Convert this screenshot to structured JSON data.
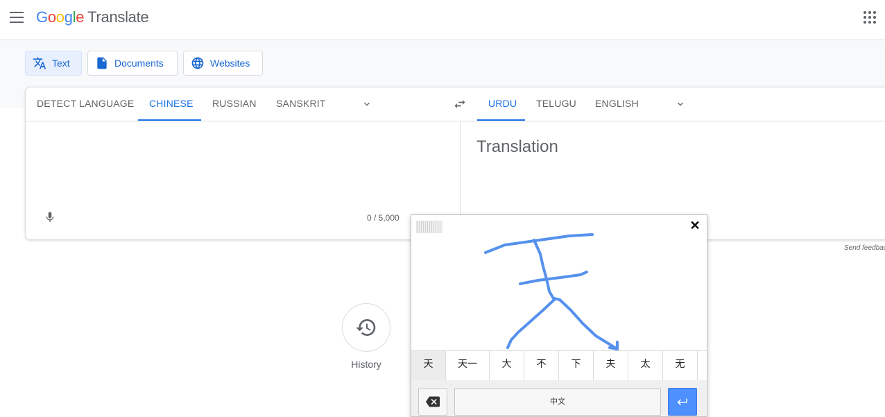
{
  "header": {
    "logo_google": [
      "G",
      "o",
      "o",
      "g",
      "l",
      "e"
    ],
    "logo_colors": [
      "#4285f4",
      "#ea4335",
      "#fbbc05",
      "#4285f4",
      "#34a853",
      "#ea4335"
    ],
    "logo_product": "Translate"
  },
  "modes": [
    {
      "label": "Text",
      "icon": "translate-icon",
      "active": true
    },
    {
      "label": "Documents",
      "icon": "document-icon",
      "active": false
    },
    {
      "label": "Websites",
      "icon": "globe-icon",
      "active": false
    }
  ],
  "source_langs": [
    "DETECT LANGUAGE",
    "CHINESE",
    "RUSSIAN",
    "SANSKRIT"
  ],
  "source_active": "CHINESE",
  "target_langs": [
    "URDU",
    "TELUGU",
    "ENGLISH"
  ],
  "target_active": "URDU",
  "input": {
    "char_count": "0 / 5,000"
  },
  "output": {
    "placeholder": "Translation"
  },
  "feedback": "Send feedback",
  "history": {
    "label": "History"
  },
  "handwriting": {
    "candidates": [
      "天",
      "天一",
      "大",
      "不",
      "下",
      "夫",
      "太",
      "无"
    ],
    "selected_index": 0,
    "space_label": "中文",
    "stroke_color": "#5591ed"
  },
  "colors": {
    "accent": "#1a73e8"
  }
}
